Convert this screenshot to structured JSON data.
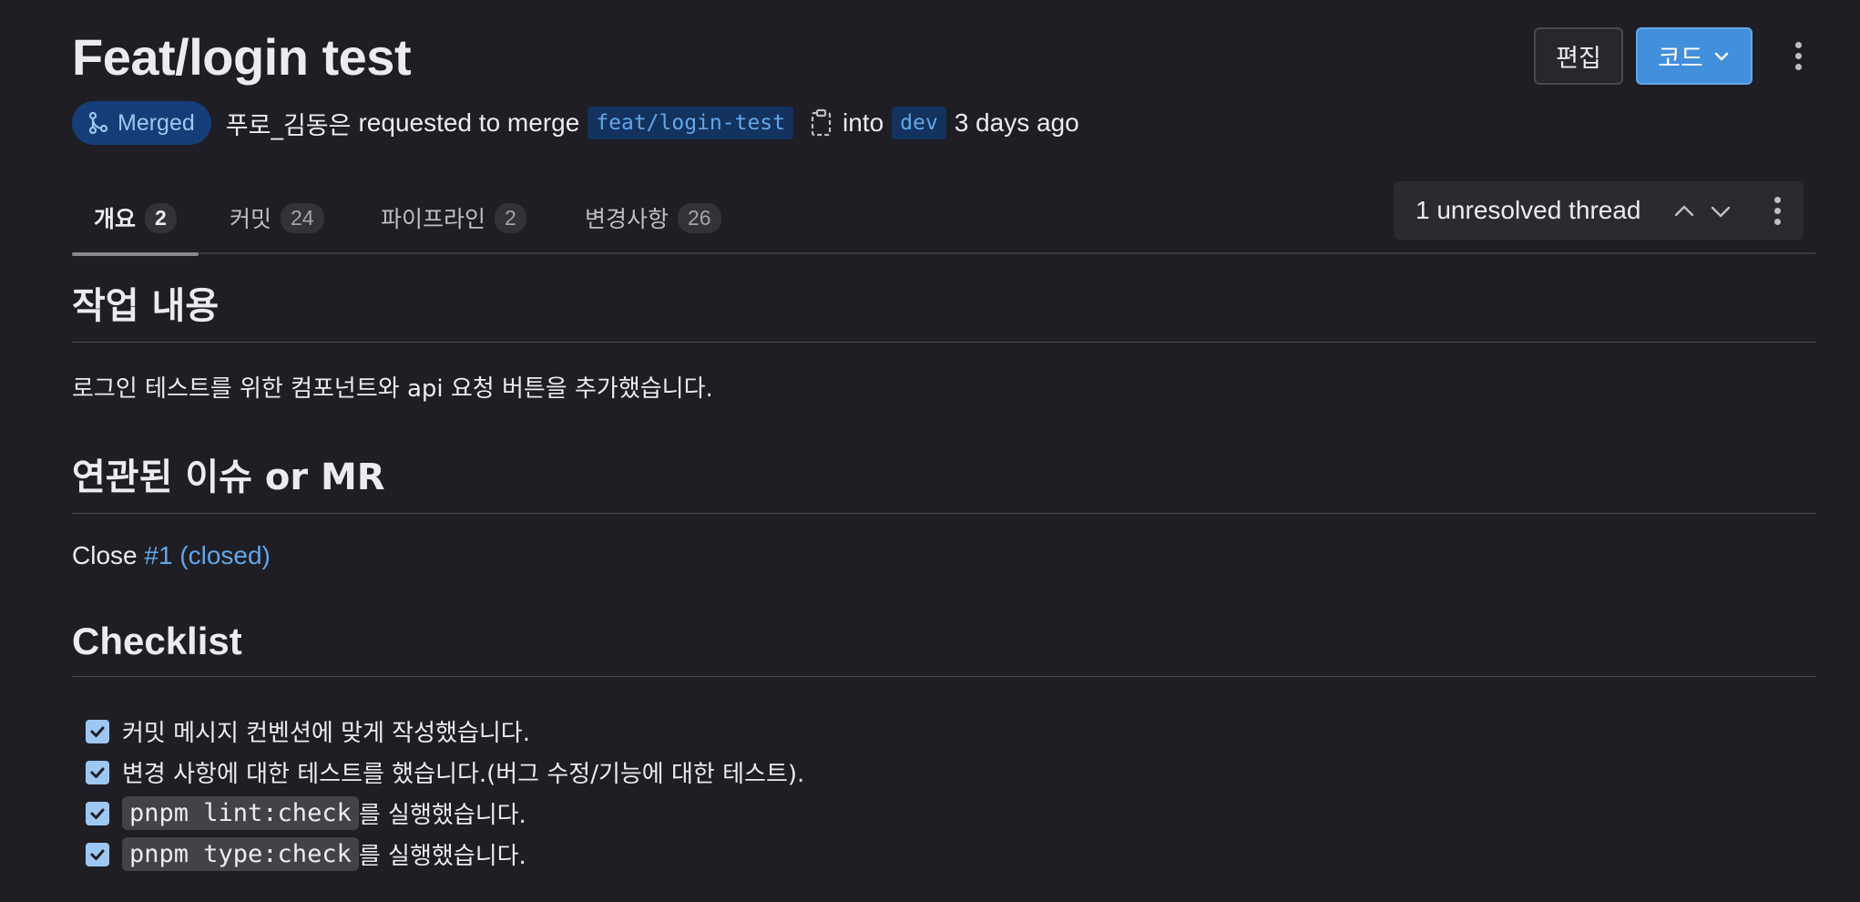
{
  "header": {
    "title": "Feat/login test",
    "edit_label": "편집",
    "code_label": "코드"
  },
  "meta": {
    "status": "Merged",
    "author": "푸로_김동은",
    "requested_text": "requested to merge",
    "source_branch": "feat/login-test",
    "into_text": "into",
    "target_branch": "dev",
    "time_ago": "3 days ago"
  },
  "tabs": [
    {
      "label": "개요",
      "count": "2"
    },
    {
      "label": "커밋",
      "count": "24"
    },
    {
      "label": "파이프라인",
      "count": "2"
    },
    {
      "label": "변경사항",
      "count": "26"
    }
  ],
  "threads": {
    "label": "1 unresolved thread"
  },
  "content": {
    "section1_title": "작업 내용",
    "section1_text": "로그인 테스트를 위한 컴포넌트와 api 요청 버튼을 추가했습니다.",
    "section2_title": "연관된 이슈 or MR",
    "close_text": "Close",
    "issue_link": "#1 (closed)",
    "section3_title": "Checklist",
    "checklist": [
      {
        "prefix": "",
        "code": "",
        "text": "커밋 메시지 컨벤션에 맞게 작성했습니다.",
        "checked": true
      },
      {
        "prefix": "",
        "code": "",
        "text": "변경 사항에 대한 테스트를 했습니다.(버그 수정/기능에 대한 테스트).",
        "checked": true
      },
      {
        "prefix": "",
        "code": "pnpm lint:check",
        "text": "를 실행했습니다.",
        "checked": true
      },
      {
        "prefix": "",
        "code": "pnpm type:check",
        "text": "를 실행했습니다.",
        "checked": true
      }
    ]
  },
  "colors": {
    "background": "#1f1e24",
    "accent": "#428fdc",
    "merged_badge_bg": "#153d77",
    "link": "#63a6e9"
  },
  "icons": {
    "merged": "merge-icon",
    "copy": "clipboard-icon",
    "chevron": "chevron-down-icon",
    "more": "kebab-icon",
    "prev": "chevron-up-icon",
    "next": "chevron-down-icon",
    "check": "checkbox-checked-icon"
  }
}
